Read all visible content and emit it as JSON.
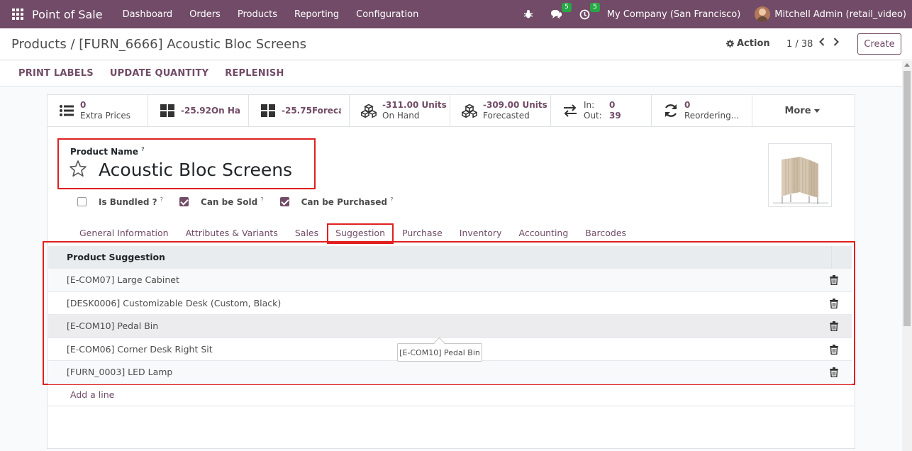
{
  "navbar": {
    "app_name": "Point of Sale",
    "menu": [
      "Dashboard",
      "Orders",
      "Products",
      "Reporting",
      "Configuration"
    ],
    "messages_count": "5",
    "activities_count": "5",
    "company": "My Company (San Francisco)",
    "user": "Mitchell Admin (retail_video)"
  },
  "control": {
    "breadcrumb_root": "Products",
    "breadcrumb_sep": "/",
    "breadcrumb_current": "[FURN_6666] Acoustic Bloc Screens",
    "action_label": "Action",
    "pager": "1 / 38",
    "create_label": "Create"
  },
  "statusbar": {
    "buttons": [
      "PRINT LABELS",
      "UPDATE QUANTITY",
      "REPLENISH"
    ]
  },
  "smart_buttons": [
    {
      "value": "0",
      "label": "Extra Prices"
    },
    {
      "value": "-25.92On Han",
      "label": ""
    },
    {
      "value": "-25.75Forecas",
      "label": ""
    },
    {
      "value": "-311.00 Units",
      "label": "On Hand"
    },
    {
      "value": "-309.00 Units",
      "label": "Forecasted"
    },
    {
      "in_label": "In:",
      "in_value": "0",
      "out_label": "Out:",
      "out_value": "39"
    },
    {
      "value": "0",
      "label": "Reordering..."
    },
    {
      "label": "More"
    }
  ],
  "product": {
    "name_label": "Product Name",
    "help_mark": "?",
    "name": "Acoustic Bloc Screens"
  },
  "checkboxes": [
    {
      "label": "Is Bundled ?",
      "checked": false
    },
    {
      "label": "Can be Sold",
      "checked": true
    },
    {
      "label": "Can be Purchased",
      "checked": true
    }
  ],
  "tabs": [
    "General Information",
    "Attributes & Variants",
    "Sales",
    "Suggestion",
    "Purchase",
    "Inventory",
    "Accounting",
    "Barcodes"
  ],
  "active_tab": "Suggestion",
  "suggestion": {
    "header": "Product Suggestion",
    "rows": [
      "[E-COM07] Large Cabinet",
      "[DESK0006] Customizable Desk (Custom, Black)",
      "[E-COM10] Pedal Bin",
      "[E-COM06] Corner Desk Right Sit",
      "[FURN_0003] LED Lamp"
    ],
    "tooltip": "[E-COM10] Pedal Bin",
    "add_line": "Add a line"
  },
  "colors": {
    "brand": "#714b67",
    "highlight": "#e02020",
    "badge": "#28a745"
  }
}
